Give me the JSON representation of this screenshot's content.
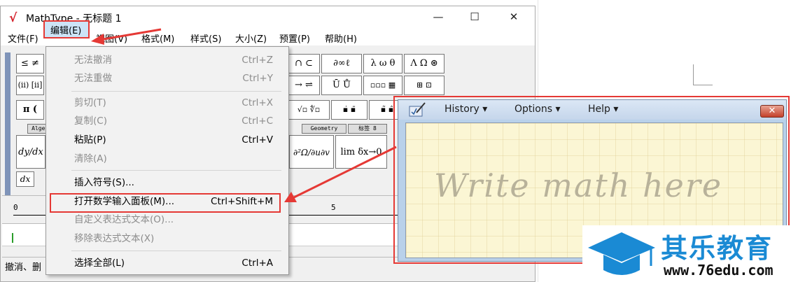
{
  "window": {
    "title": "MathType - 无标题 1",
    "minimize": "—",
    "maximize": "☐",
    "close": "✕"
  },
  "menu": [
    "文件(F)",
    "编辑(E)",
    "视图(V)",
    "格式(M)",
    "样式(S)",
    "大小(Z)",
    "预置(P)",
    "帮助(H)"
  ],
  "toolbar": {
    "row1_left": [
      "≤ ≠",
      "∩ ⊂",
      "∂∞ℓ",
      "λ ω θ",
      "Λ Ω ⊛"
    ],
    "row2_left": [
      "(ⅱ) [ⅱ]",
      "→ ⇌",
      "Ū Ů",
      "▫▫▫ ▦",
      "⊞ ⊡"
    ],
    "row3_left": [
      "π (",
      "√▫ ∜▫",
      "▪̇ ▪̄",
      "▪̃ ▪̂"
    ],
    "tabs": [
      "Algebra",
      "Geometry",
      "标签 8"
    ],
    "templates": [
      "dy/dx",
      "∂²Ω/∂u∂v",
      "lim δx→0"
    ],
    "dx_label": "dx"
  },
  "ruler": {
    "start": "0",
    "mid": "5"
  },
  "status": "撤消、删",
  "edit_menu": {
    "items": [
      {
        "label": "无法撤消",
        "key": "Ctrl+Z",
        "enabled": false
      },
      {
        "label": "无法重做",
        "key": "Ctrl+Y",
        "enabled": false
      },
      {
        "label": "剪切(T)",
        "key": "Ctrl+X",
        "enabled": false
      },
      {
        "label": "复制(C)",
        "key": "Ctrl+C",
        "enabled": false
      },
      {
        "label": "粘贴(P)",
        "key": "Ctrl+V",
        "enabled": true
      },
      {
        "label": "清除(A)",
        "key": "",
        "enabled": false
      },
      {
        "label": "插入符号(S)...",
        "key": "",
        "enabled": true
      },
      {
        "label": "打开数学输入面板(M)...",
        "key": "Ctrl+Shift+M",
        "enabled": true
      },
      {
        "label": "自定义表达式文本(O)...",
        "key": "",
        "enabled": false
      },
      {
        "label": "移除表达式文本(X)",
        "key": "",
        "enabled": false
      },
      {
        "label": "选择全部(L)",
        "key": "Ctrl+A",
        "enabled": true
      }
    ]
  },
  "math_panel": {
    "menus": [
      "History ▾",
      "Options ▾",
      "Help ▾"
    ],
    "close": "✕",
    "placeholder": "Write math here"
  },
  "watermark": {
    "brand": "其乐教育",
    "url": "www.76edu.com"
  },
  "colors": {
    "highlight_red": "#e53935",
    "brand_blue": "#1a8ad4",
    "panel_bg": "#fbf6d4"
  }
}
